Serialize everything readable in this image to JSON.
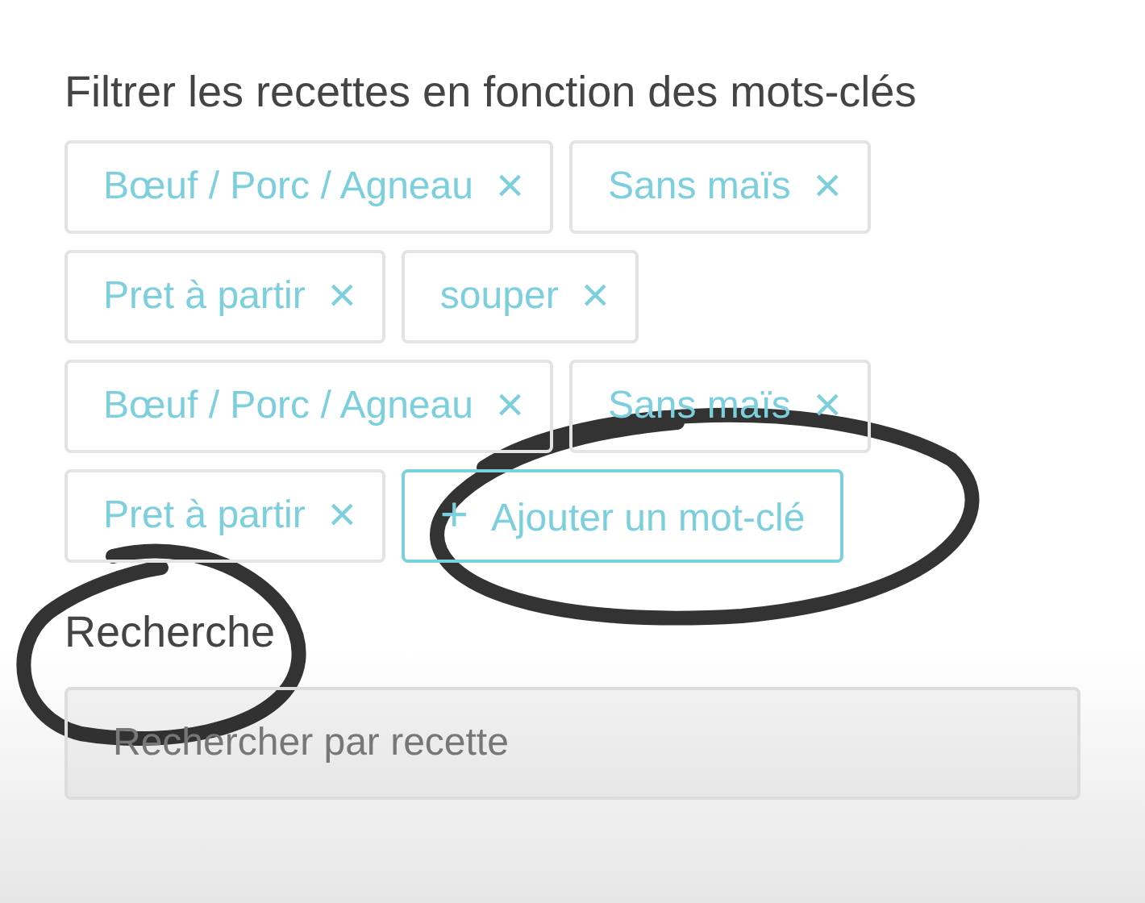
{
  "filter_heading": "Filtrer les recettes en fonction des mots-clés",
  "tags": [
    {
      "label": "Bœuf / Porc / Agneau",
      "remove": "×"
    },
    {
      "label": "Sans maïs",
      "remove": "×"
    },
    {
      "label": "Pret à partir",
      "remove": "×"
    },
    {
      "label": "souper",
      "remove": "×"
    },
    {
      "label": "Bœuf / Porc / Agneau",
      "remove": "×"
    },
    {
      "label": "Sans maïs",
      "remove": "×"
    },
    {
      "label": "Pret à partir",
      "remove": "×"
    }
  ],
  "add_button": {
    "icon": "+",
    "label": "Ajouter un mot-clé"
  },
  "search_heading": "Recherche",
  "search": {
    "placeholder": "Rechercher par recette"
  },
  "annotations": [
    {
      "kind": "circle"
    },
    {
      "kind": "circle"
    }
  ]
}
